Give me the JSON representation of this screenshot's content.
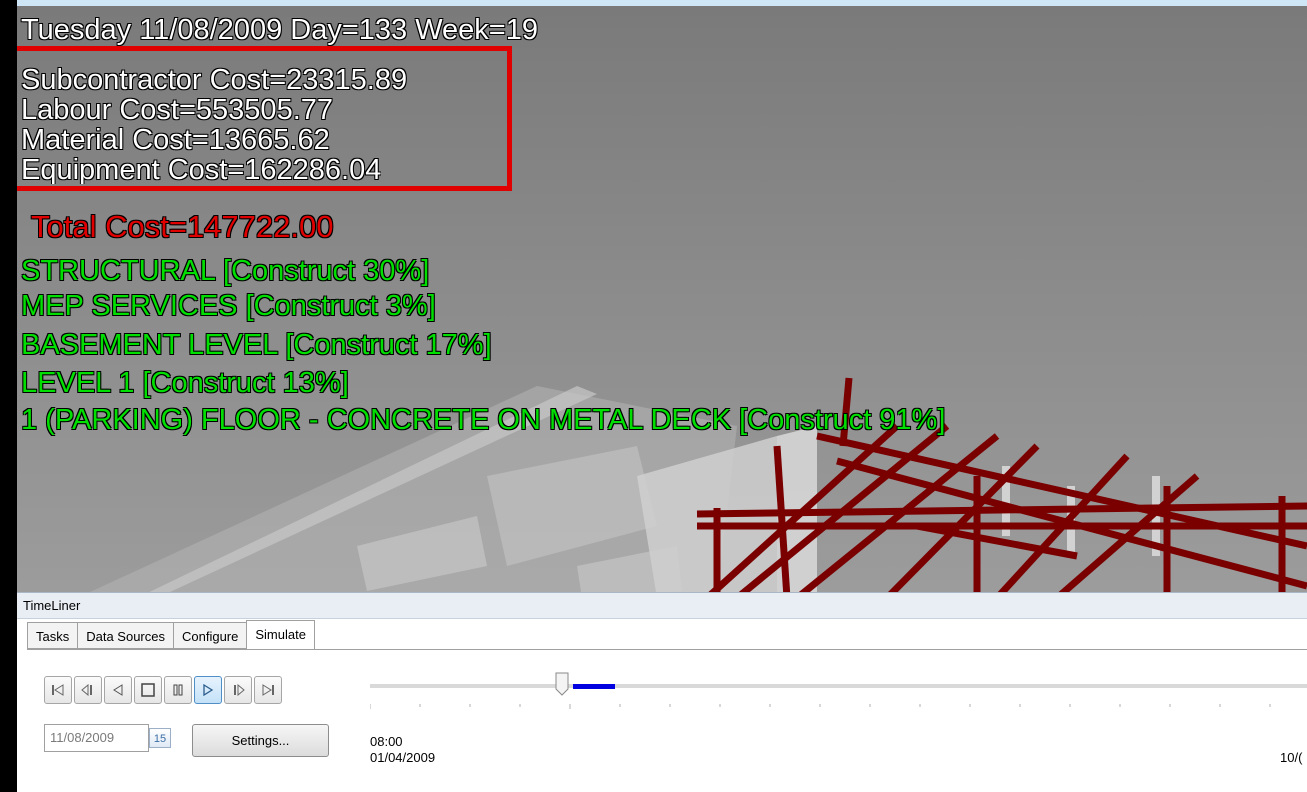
{
  "overlay": {
    "date_line": "Tuesday 11/08/2009 Day=133 Week=19",
    "costs": [
      "Subcontractor Cost=23315.89",
      "Labour Cost=553505.77",
      "Material Cost=13665.62",
      "Equipment Cost=162286.04"
    ],
    "total": "Total Cost=147722.00",
    "tasks": [
      "STRUCTURAL [Construct 30%]",
      "MEP SERVICES [Construct 3%]",
      "BASEMENT LEVEL [Construct 17%]",
      "LEVEL 1 [Construct 13%]",
      "1 (PARKING) FLOOR - CONCRETE ON METAL DECK [Construct 91%]"
    ],
    "colors": {
      "cost_text": "#ffffff",
      "total_text": "#e00000",
      "task_text": "#00e000",
      "highlight_box": "#e00000",
      "steel": "#7a0000"
    }
  },
  "timeliner": {
    "title": "TimeLiner",
    "tabs": [
      "Tasks",
      "Data Sources",
      "Configure",
      "Simulate"
    ],
    "active_tab": "Simulate",
    "controls": [
      "rewind-to-start-icon",
      "step-back-icon",
      "play-reverse-icon",
      "stop-icon",
      "pause-icon",
      "play-icon",
      "step-forward-icon",
      "forward-to-end-icon"
    ],
    "date_value": "11/08/2009",
    "calendar_label": "15",
    "settings_label": "Settings...",
    "start_time": "08:00",
    "start_date": "01/04/2009",
    "end_date_partial": "10/("
  }
}
